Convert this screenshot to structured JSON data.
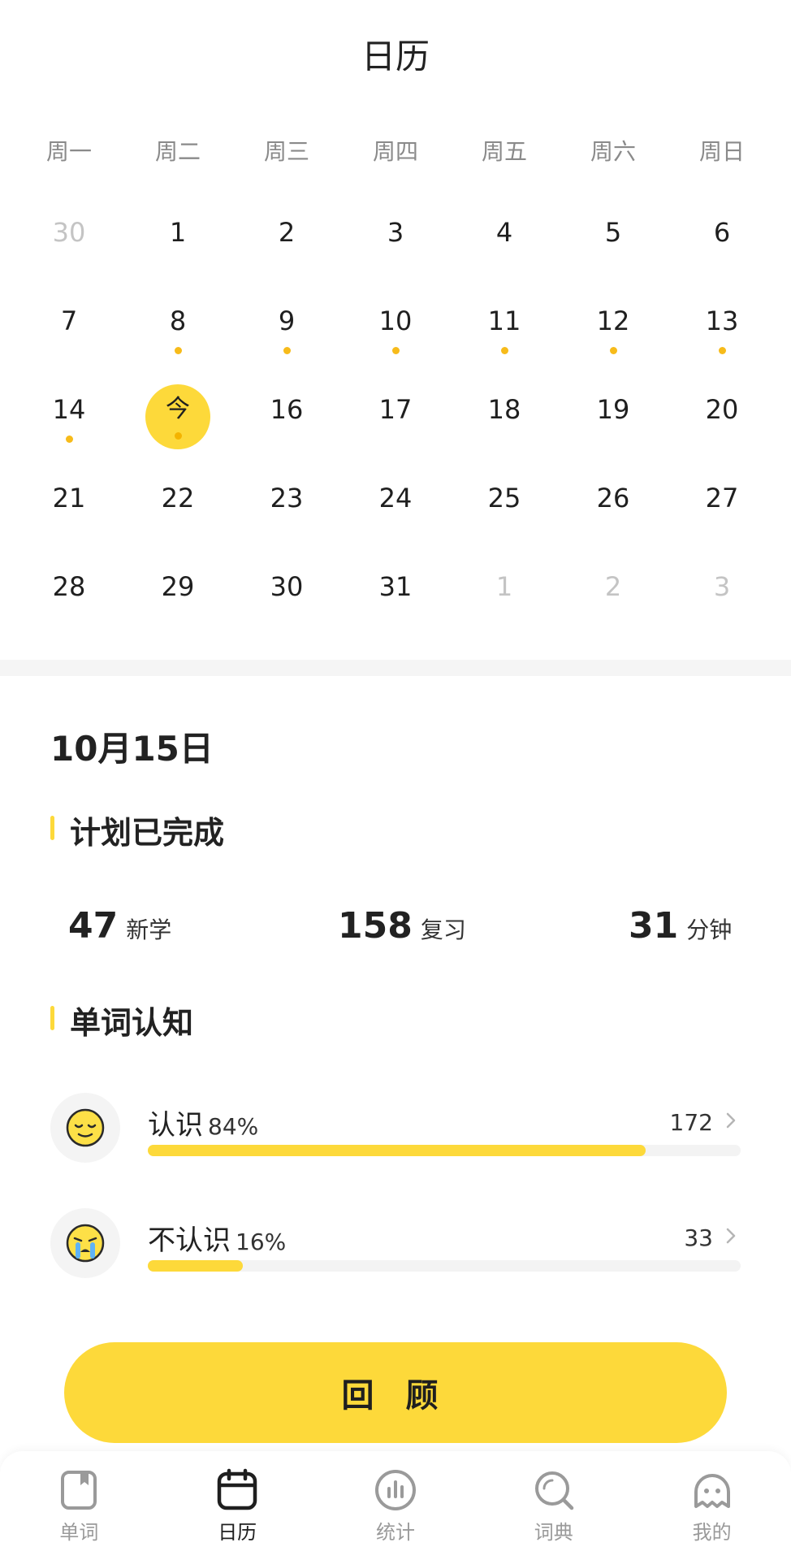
{
  "header": {
    "title": "日历"
  },
  "weekdays": [
    "周一",
    "周二",
    "周三",
    "周四",
    "周五",
    "周六",
    "周日"
  ],
  "calendar": {
    "rows": [
      [
        {
          "label": "30",
          "muted": true
        },
        {
          "label": "1"
        },
        {
          "label": "2"
        },
        {
          "label": "3"
        },
        {
          "label": "4"
        },
        {
          "label": "5"
        },
        {
          "label": "6"
        }
      ],
      [
        {
          "label": "7"
        },
        {
          "label": "8",
          "dot": true
        },
        {
          "label": "9",
          "dot": true
        },
        {
          "label": "10",
          "dot": true
        },
        {
          "label": "11",
          "dot": true
        },
        {
          "label": "12",
          "dot": true
        },
        {
          "label": "13",
          "dot": true
        }
      ],
      [
        {
          "label": "14",
          "dot": true
        },
        {
          "label": "今",
          "today": true,
          "dot": true
        },
        {
          "label": "16"
        },
        {
          "label": "17"
        },
        {
          "label": "18"
        },
        {
          "label": "19"
        },
        {
          "label": "20"
        }
      ],
      [
        {
          "label": "21"
        },
        {
          "label": "22"
        },
        {
          "label": "23"
        },
        {
          "label": "24"
        },
        {
          "label": "25"
        },
        {
          "label": "26"
        },
        {
          "label": "27"
        }
      ],
      [
        {
          "label": "28"
        },
        {
          "label": "29"
        },
        {
          "label": "30"
        },
        {
          "label": "31"
        },
        {
          "label": "1",
          "muted": true
        },
        {
          "label": "2",
          "muted": true
        },
        {
          "label": "3",
          "muted": true
        }
      ]
    ]
  },
  "selected_date": "10月15日",
  "plan": {
    "title": "计划已完成",
    "new_count": "47",
    "new_label": "新学",
    "review_count": "158",
    "review_label": "复习",
    "minutes": "31",
    "minutes_label": "分钟"
  },
  "cognition": {
    "title": "单词认知",
    "known": {
      "label": "认识",
      "percent_text": "84%",
      "percent": 0.84,
      "count": "172"
    },
    "unknown": {
      "label": "不认识",
      "percent_text": "16%",
      "percent": 0.16,
      "count": "33"
    }
  },
  "review_button": "回 顾",
  "tabs": [
    {
      "label": "单词",
      "icon": "book-icon",
      "active": false
    },
    {
      "label": "日历",
      "icon": "calendar-icon",
      "active": true
    },
    {
      "label": "统计",
      "icon": "stats-icon",
      "active": false
    },
    {
      "label": "词典",
      "icon": "search-icon",
      "active": false
    },
    {
      "label": "我的",
      "icon": "profile-icon",
      "active": false
    }
  ],
  "colors": {
    "accent": "#fdd93a",
    "dot": "#f7bb1a",
    "muted_text": "#c4c4c4"
  }
}
